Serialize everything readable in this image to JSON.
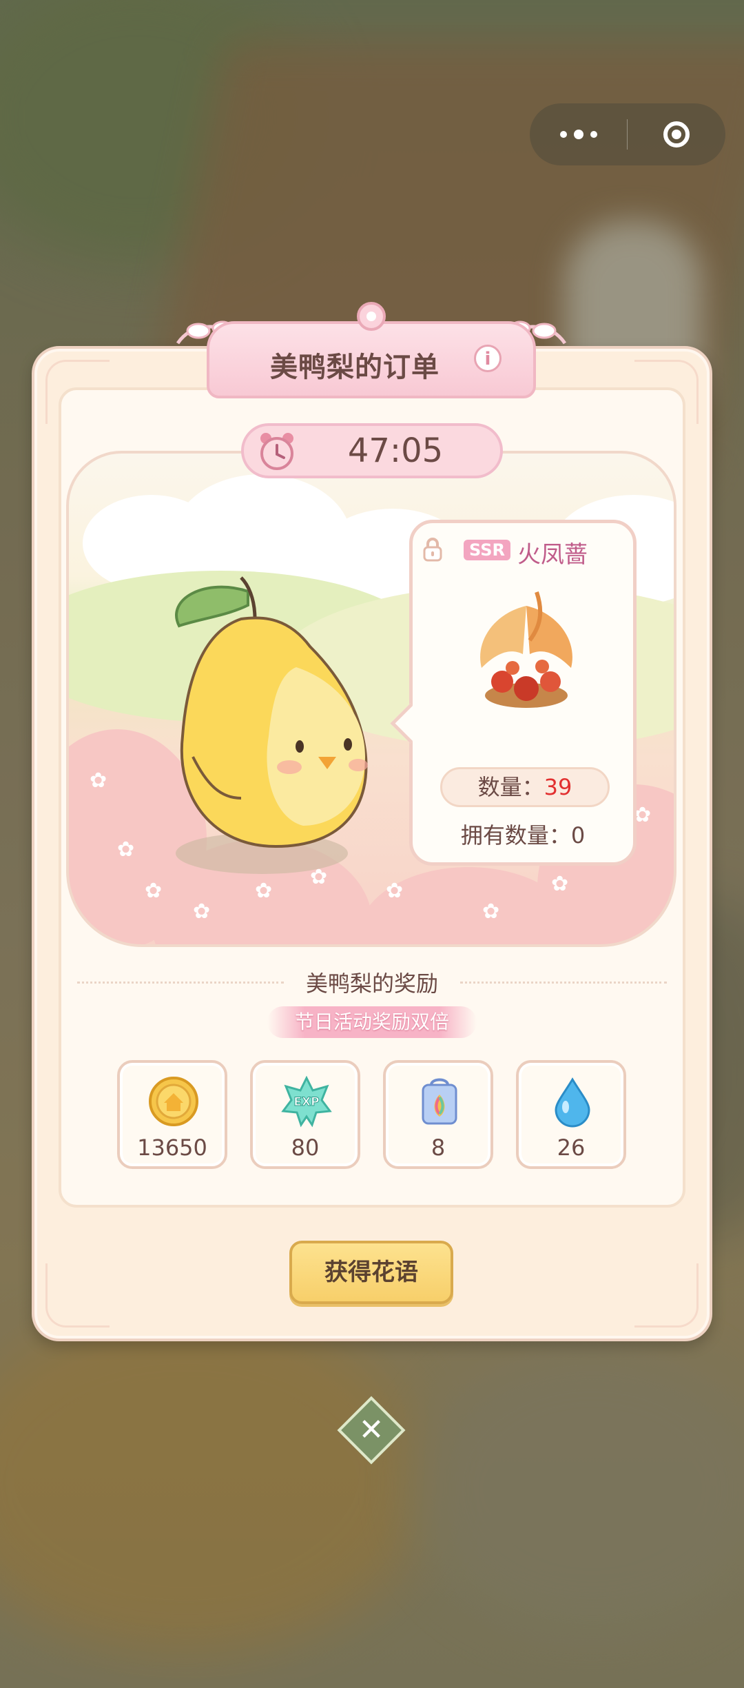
{
  "capsule": {
    "more_icon": "more-dots-icon",
    "close_icon": "target-circle-icon"
  },
  "order": {
    "title": "美鸭梨的订单",
    "info_icon": "i",
    "timer": "47:05"
  },
  "item": {
    "rarity": "SSR",
    "name": "火凤蔷",
    "quantity_label": "数量：",
    "quantity_value": "39",
    "owned_label": "拥有数量：",
    "owned_value": "0"
  },
  "rewards": {
    "title": "美鸭梨的奖励",
    "double_banner": "节日活动奖励双倍",
    "items": [
      {
        "icon": "gold-coin-icon",
        "value": "13650"
      },
      {
        "icon": "exp-star-icon",
        "value": "80"
      },
      {
        "icon": "seed-bag-icon",
        "value": "8"
      },
      {
        "icon": "water-drop-icon",
        "value": "26"
      }
    ]
  },
  "action_button": "获得花语",
  "close_button": "✕",
  "colors": {
    "accent_pink": "#f7b3c6",
    "button_yellow": "#f7cf6a",
    "quantity_red": "#e23030"
  }
}
